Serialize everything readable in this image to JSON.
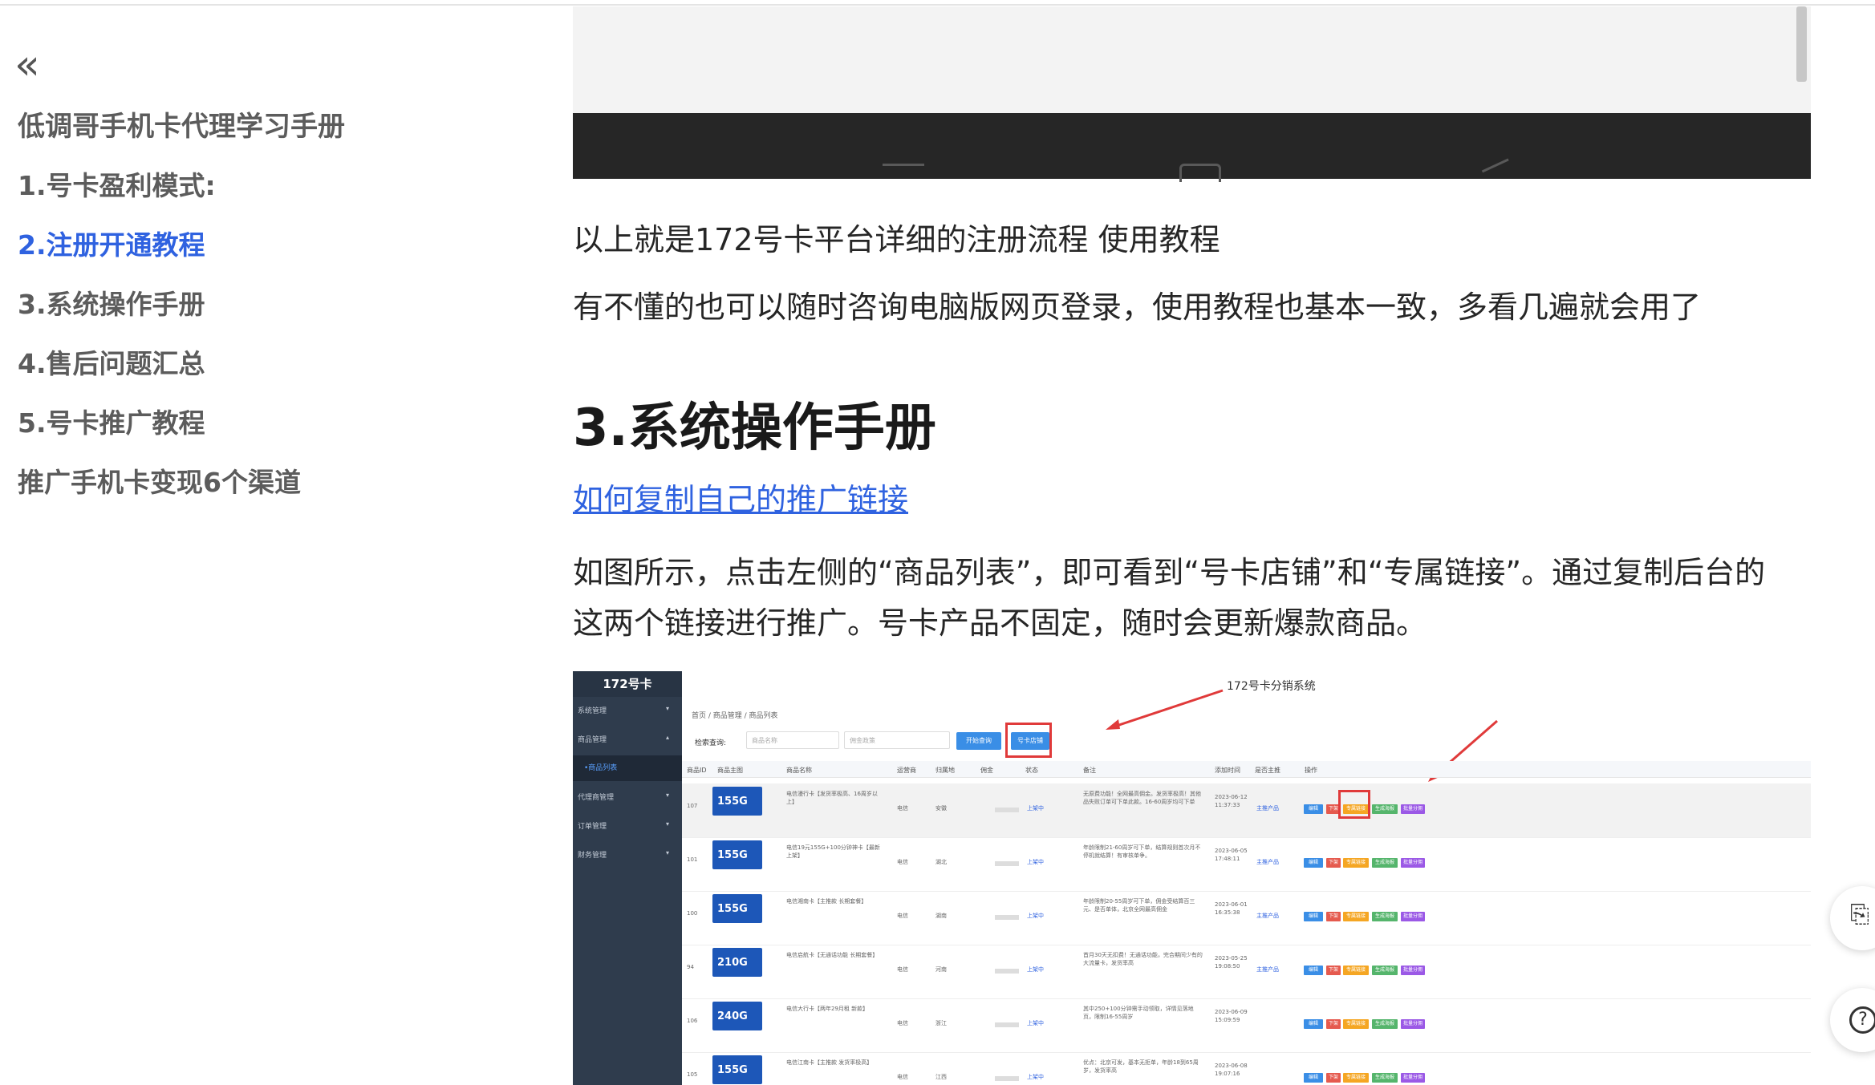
{
  "sidebar": {
    "collapse_glyph": "«",
    "book_title": "低调哥手机卡代理学习手册",
    "items": [
      {
        "label": "1.号卡盈利模式:"
      },
      {
        "label": "2.注册开通教程",
        "active": true
      },
      {
        "label": "3.系统操作手册"
      },
      {
        "label": "4.售后问题汇总"
      },
      {
        "label": "5.号卡推广教程"
      },
      {
        "label": "推广手机卡变现6个渠道"
      }
    ]
  },
  "article": {
    "para1": "以上就是172号卡平台详细的注册流程 使用教程",
    "para2": "有不懂的也可以随时咨询电脑版网页登录，使用教程也基本一致，多看几遍就会用了",
    "heading": "3.系统操作手册",
    "link": "如何复制自己的推广链接",
    "para3_line1": "如图所示，点击左侧的“商品列表”，即可看到“号卡店铺”和“专属链接”。通过复制后台的",
    "para3_line2": "这两个链接进行推广。号卡产品不固定，随时会更新爆款商品。"
  },
  "embedded": {
    "logo": "172号卡",
    "system_label": "172号卡分销系统",
    "menu": [
      "系统管理",
      "商品管理",
      "•商品列表",
      "代理商管理",
      "订单管理",
      "财务管理"
    ],
    "breadcrumb": "首页 / 商品管理 / 商品列表",
    "search_label": "检索查询:",
    "input_name_ph": "商品名称",
    "input_select_ph": "佣金政策",
    "btn_search": "开始查询",
    "btn_store": "号卡店铺",
    "headers": [
      "商品ID",
      "商品主图",
      "商品名称",
      "运营商",
      "归属地",
      "佣金",
      "状态",
      "备注",
      "添加时间",
      "是否主推",
      "操作"
    ],
    "action_buttons": [
      "编辑",
      "下架",
      "专属链接",
      "生成海报",
      "批量分佣"
    ],
    "rows": [
      {
        "id": "107",
        "badge": "155G",
        "name": "电信漫行卡【发货率极高、16周岁以上】",
        "op": "电信",
        "loc": "安徽",
        "status": "上架中",
        "note": "无原费功能！全网最高佣金。发货率极高！其他品失败订单可下单此款。16-60周岁均可下单",
        "time": "2023-06-12 11:37:33",
        "rec": "主推产品"
      },
      {
        "id": "101",
        "badge": "155G",
        "name": "电信19元155G+100分钟神卡【最新上架】",
        "op": "电信",
        "loc": "湖北",
        "status": "上架中",
        "note": "年龄限制21-60周岁可下单，结算规则首次月不停机就结算！有审核单争。",
        "time": "2023-06-05 17:48:11",
        "rec": "主推产品"
      },
      {
        "id": "100",
        "badge": "155G",
        "name": "电信湘南卡【主推款 长期套餐】",
        "op": "电信",
        "loc": "湖南",
        "status": "上架中",
        "note": "年龄限制20-55周岁可下单，佣金受结算百三元、是否单体，北京全网最高佣金",
        "time": "2023-06-01 16:35:38",
        "rec": "主推产品"
      },
      {
        "id": "94",
        "badge": "210G",
        "name": "电信启航卡【无通话功能 长期套餐】",
        "op": "电信",
        "loc": "河南",
        "status": "上架中",
        "note": "首月30天无扣费！无通话功能，完合期间少有的大流量卡，发货率高",
        "time": "2023-05-25 19:08:50",
        "rec": "主推产品"
      },
      {
        "id": "106",
        "badge": "240G",
        "name": "电信大行卡【两年29月租 新款】",
        "op": "电信",
        "loc": "浙江",
        "status": "上架中",
        "note": "其中250+100分钟需手动领取，详情见落地页，限制16-55周岁",
        "time": "2023-06-09 15:09:59",
        "rec": ""
      },
      {
        "id": "105",
        "badge": "155G",
        "name": "电信江南卡【主推款 发货率极高】",
        "op": "电信",
        "loc": "江西",
        "status": "上架中",
        "note": "优点：北京可发，基本无拒单，年龄18到65周岁，发货率高",
        "time": "2023-06-08 19:07:16",
        "rec": ""
      }
    ]
  },
  "float_buttons": [
    {
      "icon": "⎘"
    },
    {
      "icon": "?"
    }
  ]
}
